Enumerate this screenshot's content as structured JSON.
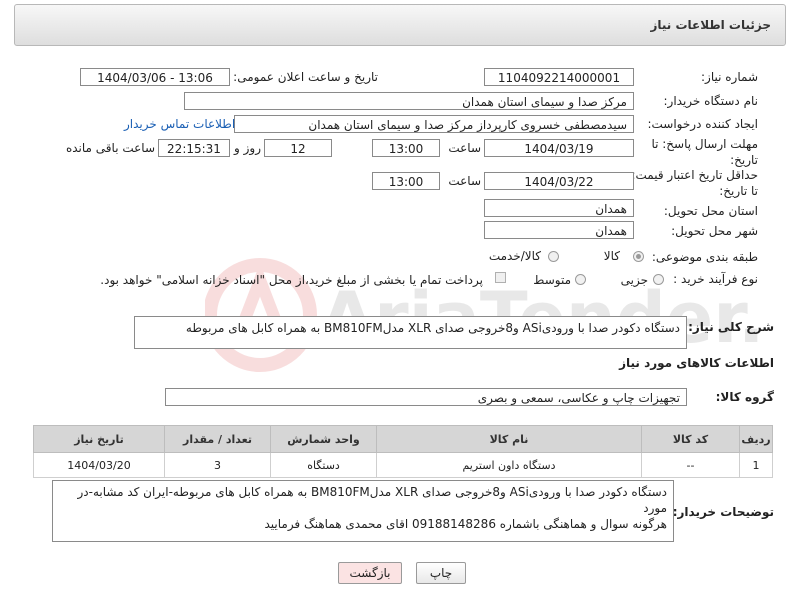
{
  "header": {
    "title": "جزئیات اطلاعات نیاز"
  },
  "form": {
    "need_number_label": "شماره نیاز:",
    "need_number": "1104092214000001",
    "announce_label": "تاریخ و ساعت اعلان عمومی:",
    "announce_value": "1404/03/06 - 13:06",
    "buyer_org_label": "نام دستگاه خریدار:",
    "buyer_org": "مرکز صدا و سیمای استان همدان",
    "creator_label": "ایجاد کننده درخواست:",
    "creator": "سیدمصطفی خسروی کارپرداز مرکز صدا و سیمای استان همدان",
    "contact_link": "اطلاعات تماس خریدار",
    "deadline_label_1": "مهلت ارسال پاسخ: تا",
    "deadline_label_2": "تاریخ:",
    "deadline_date": "1404/03/19",
    "time_label": "ساعت",
    "deadline_time": "13:00",
    "days": "12",
    "days_label": "روز و",
    "remaining_time": "22:15:31",
    "remaining_label": "ساعت باقی مانده",
    "validity_label_1": "حداقل تاریخ اعتبار قیمت:",
    "validity_label_2": "تا تاریخ:",
    "validity_date": "1404/03/22",
    "validity_time": "13:00",
    "province_label": "استان محل تحویل:",
    "province": "همدان",
    "city_label": "شهر محل تحویل:",
    "city": "همدان",
    "category_label": "طبقه بندی موضوعی:",
    "category_options": [
      "کالا",
      "کالا/خدمت"
    ],
    "category_selected": "کالا",
    "process_label": "نوع فرآیند خرید :",
    "process_options": [
      "جزیی",
      "متوسط"
    ],
    "payment_note": "پرداخت تمام یا بخشی از مبلغ خرید،از محل \"اسناد خزانه اسلامی\" خواهد بود.",
    "summary_label": "شرح کلی نیاز:",
    "summary": "دستگاه دکودر صدا با ورودیASi و8خروجی صدای XLR مدلBM810FM به همراه کابل های مربوطه"
  },
  "goods": {
    "section_title": "اطلاعات کالاهای مورد نیاز",
    "group_label": "گروه کالا:",
    "group_value": "تجهیزات چاپ و عکاسی، سمعی و بصری",
    "columns": [
      "ردیف",
      "کد کالا",
      "نام کالا",
      "واحد شمارش",
      "تعداد / مقدار",
      "تاریخ نیاز"
    ],
    "rows": [
      [
        "1",
        "--",
        "دستگاه داون استریم",
        "دستگاه",
        "3",
        "1404/03/20"
      ]
    ]
  },
  "notes": {
    "label": "توضیحات خریدار:",
    "line1": "دستگاه دکودر صدا با ورودیASi و8خروجی صدای XLR مدلBM810FM به همراه کابل های مربوطه-ایران کد مشابه-در مورد",
    "line2": "هرگونه سوال و هماهنگی باشماره 09188148286 اقای محمدی هماهنگ فرمایید"
  },
  "buttons": {
    "print": "چاپ",
    "back": "بازگشت"
  },
  "watermark_text": "AriaTender.net",
  "colors": {
    "link": "#1a5fb4",
    "back_button": "#fbe3e3",
    "header_bg": "#e6e6e6"
  }
}
